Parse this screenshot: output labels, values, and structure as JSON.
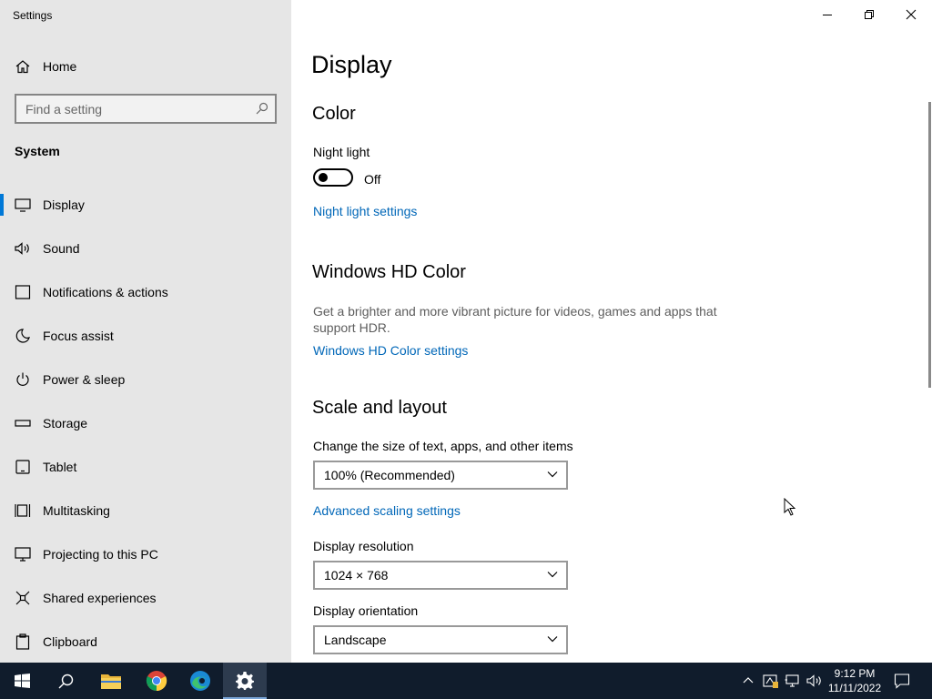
{
  "window": {
    "title": "Settings"
  },
  "sidebar": {
    "home_label": "Home",
    "search_placeholder": "Find a setting",
    "section_title": "System",
    "items": [
      {
        "label": "Display",
        "icon": "monitor-icon",
        "active": true
      },
      {
        "label": "Sound",
        "icon": "speaker-icon"
      },
      {
        "label": "Notifications & actions",
        "icon": "notification-icon"
      },
      {
        "label": "Focus assist",
        "icon": "moon-icon"
      },
      {
        "label": "Power & sleep",
        "icon": "power-icon"
      },
      {
        "label": "Storage",
        "icon": "storage-icon"
      },
      {
        "label": "Tablet",
        "icon": "tablet-icon"
      },
      {
        "label": "Multitasking",
        "icon": "multitasking-icon"
      },
      {
        "label": "Projecting to this PC",
        "icon": "projecting-icon"
      },
      {
        "label": "Shared experiences",
        "icon": "shared-experiences-icon"
      },
      {
        "label": "Clipboard",
        "icon": "clipboard-icon"
      }
    ]
  },
  "main": {
    "page_title": "Display",
    "color": {
      "heading": "Color",
      "night_light_label": "Night light",
      "night_light_state": "Off",
      "night_light_link": "Night light settings"
    },
    "hd_color": {
      "heading": "Windows HD Color",
      "description": "Get a brighter and more vibrant picture for videos, games and apps that support HDR.",
      "link": "Windows HD Color settings"
    },
    "scale": {
      "heading": "Scale and layout",
      "size_label": "Change the size of text, apps, and other items",
      "size_value": "100% (Recommended)",
      "advanced_link": "Advanced scaling settings",
      "resolution_label": "Display resolution",
      "resolution_value": "1024 × 768",
      "orientation_label": "Display orientation",
      "orientation_value": "Landscape"
    }
  },
  "taskbar": {
    "apps": [
      "start-icon",
      "search-icon",
      "file-explorer-icon",
      "chrome-icon",
      "edge-icon",
      "settings-icon"
    ],
    "time": "9:12 PM",
    "date": "11/11/2022"
  },
  "colors": {
    "accent": "#0078d7",
    "link": "#0067b8",
    "sidebar_bg": "#e6e6e6",
    "taskbar_bg": "#101c2c"
  }
}
